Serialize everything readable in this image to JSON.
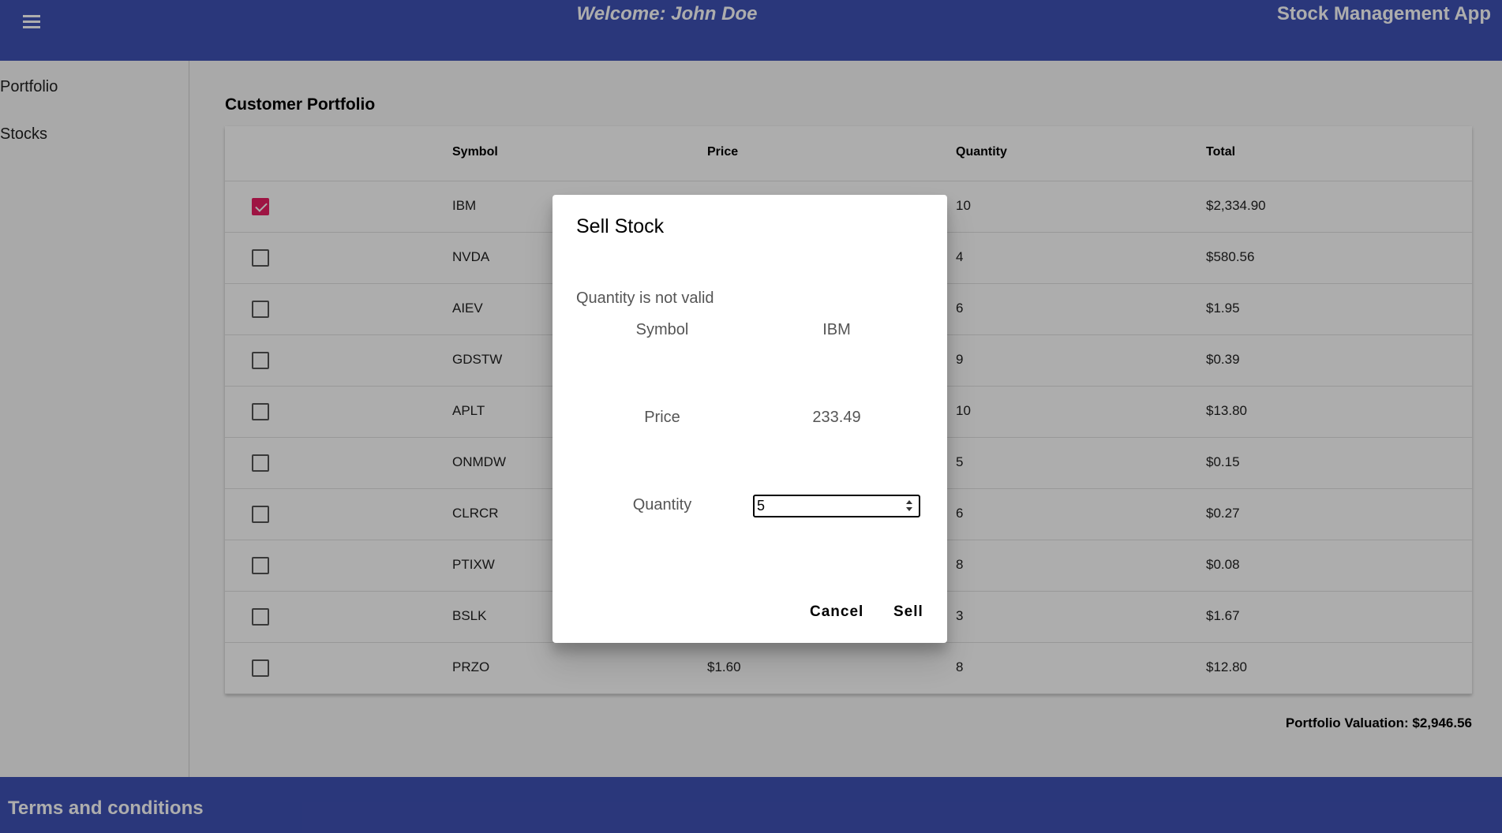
{
  "header": {
    "welcome": "Welcome: John Doe",
    "app_title": "Stock Management App",
    "menu_icon": "menu-icon"
  },
  "sidebar": {
    "items": [
      {
        "label": "Portfolio"
      },
      {
        "label": "Stocks"
      }
    ]
  },
  "main": {
    "title": "Customer Portfolio",
    "columns": [
      "Symbol",
      "Price",
      "Quantity",
      "Total"
    ],
    "rows": [
      {
        "checked": true,
        "symbol": "IBM",
        "price": "",
        "quantity": "10",
        "total": "$2,334.90"
      },
      {
        "checked": false,
        "symbol": "NVDA",
        "price": "",
        "quantity": "4",
        "total": "$580.56"
      },
      {
        "checked": false,
        "symbol": "AIEV",
        "price": "",
        "quantity": "6",
        "total": "$1.95"
      },
      {
        "checked": false,
        "symbol": "GDSTW",
        "price": "",
        "quantity": "9",
        "total": "$0.39"
      },
      {
        "checked": false,
        "symbol": "APLT",
        "price": "",
        "quantity": "10",
        "total": "$13.80"
      },
      {
        "checked": false,
        "symbol": "ONMDW",
        "price": "",
        "quantity": "5",
        "total": "$0.15"
      },
      {
        "checked": false,
        "symbol": "CLRCR",
        "price": "",
        "quantity": "6",
        "total": "$0.27"
      },
      {
        "checked": false,
        "symbol": "PTIXW",
        "price": "",
        "quantity": "8",
        "total": "$0.08"
      },
      {
        "checked": false,
        "symbol": "BSLK",
        "price": "",
        "quantity": "3",
        "total": "$1.67"
      },
      {
        "checked": false,
        "symbol": "PRZO",
        "price": "$1.60",
        "quantity": "8",
        "total": "$12.80"
      }
    ],
    "valuation": "Portfolio Valuation: $2,946.56"
  },
  "footer": {
    "text": "Terms and conditions"
  },
  "dialog": {
    "title": "Sell Stock",
    "error": "Quantity is not valid",
    "symbol_label": "Symbol",
    "symbol_value": "IBM",
    "price_label": "Price",
    "price_value": "233.49",
    "quantity_label": "Quantity",
    "quantity_value": "5",
    "cancel_label": "Cancel",
    "sell_label": "Sell"
  },
  "colors": {
    "primary": "#3f51b5",
    "accent": "#e91e63"
  }
}
